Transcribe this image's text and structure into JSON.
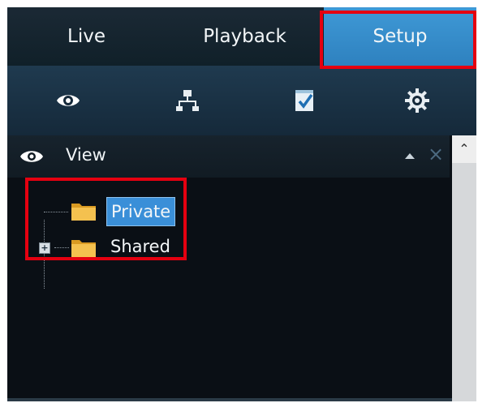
{
  "tabs": [
    {
      "label": "Live"
    },
    {
      "label": "Playback"
    },
    {
      "label": "Setup",
      "active": true
    }
  ],
  "toolbar": {
    "icons": [
      "eye-icon",
      "network-icon",
      "checklist-icon",
      "gear-icon"
    ]
  },
  "panel": {
    "title": "View",
    "icon": "eye-icon"
  },
  "tree": {
    "nodes": [
      {
        "label": "Private",
        "selected": true
      },
      {
        "label": "Shared",
        "expandable": true
      }
    ]
  },
  "colors": {
    "active_tab": "#2e81bf",
    "selection": "#3a8fd8",
    "annotation_red": "#e50010",
    "background": "#0a0f15"
  }
}
